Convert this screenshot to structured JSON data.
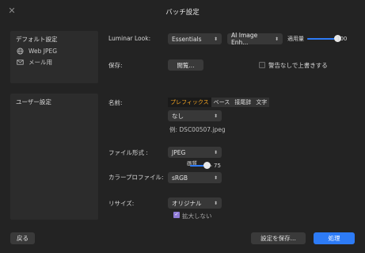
{
  "window": {
    "title": "バッチ設定"
  },
  "default_panel": {
    "heading": "デフォルト設定",
    "items": [
      {
        "label": "Web JPEG",
        "icon": "globe-icon"
      },
      {
        "label": "メール用",
        "icon": "mail-icon"
      }
    ]
  },
  "user_panel": {
    "heading": "ユーザー設定"
  },
  "luminar": {
    "label": "Luminar Look:",
    "look_value": "Essentials",
    "ai_value": "AI Image Enh...",
    "amount_label": "適用量",
    "amount_value": "100",
    "amount_fraction": 1.0
  },
  "save": {
    "label": "保存:",
    "browse_label": "閲覧...",
    "overwrite_label": "警告なしで上書きする",
    "overwrite_checked": false
  },
  "name": {
    "label": "名前:",
    "tabs": [
      "プレフィックス",
      "ベース",
      "接尾辞",
      "文字"
    ],
    "active_tab": 0,
    "value": "なし",
    "example": "例: DSC00507.jpeg"
  },
  "format": {
    "label": "ファイル形式 :",
    "value": "JPEG",
    "quality_label": "画質",
    "quality_value": "75",
    "quality_fraction": 0.75
  },
  "color_profile": {
    "label": "カラープロファイル:",
    "value": "sRGB"
  },
  "resize": {
    "label": "リサイズ:",
    "value": "オリジナル",
    "no_enlarge_label": "拡大しない",
    "no_enlarge_checked": true
  },
  "footer": {
    "back_label": "戻る",
    "save_settings_label": "設定を保存...",
    "process_label": "処理"
  },
  "colors": {
    "accent": "#2d7bf6",
    "active_tab_text": "#f5a623"
  }
}
